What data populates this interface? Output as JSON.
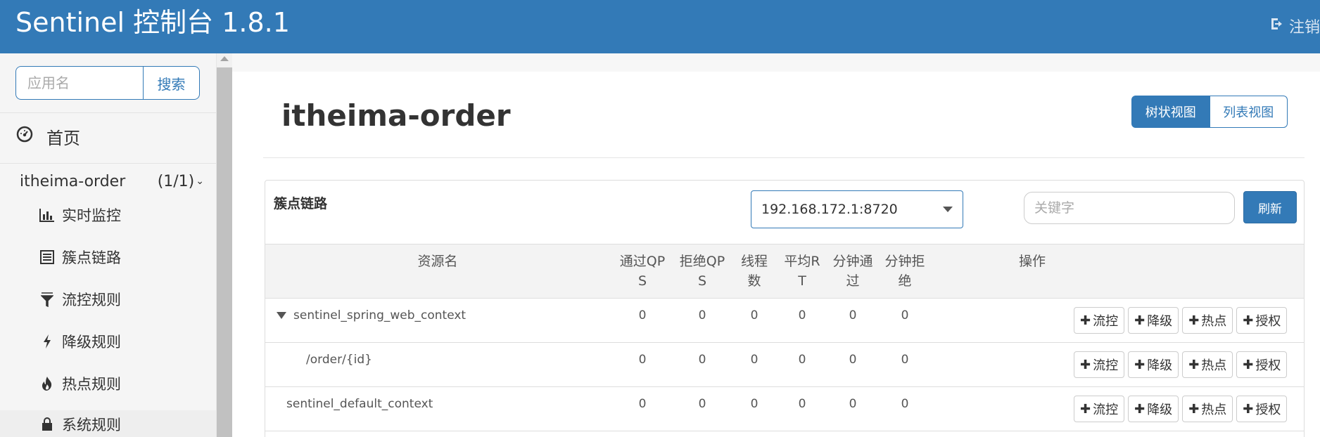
{
  "header": {
    "brand": "Sentinel 控制台 1.8.1",
    "logout_label": "注销",
    "logout_icon": "sign-out-icon"
  },
  "sidebar": {
    "search": {
      "placeholder": "应用名",
      "button_label": "搜索"
    },
    "home": {
      "label": "首页",
      "icon": "dashboard-icon"
    },
    "app": {
      "name": "itheima-order",
      "count": "(1/1)"
    },
    "items": [
      {
        "label": "实时监控",
        "icon": "bar-chart-icon"
      },
      {
        "label": "簇点链路",
        "icon": "list-icon"
      },
      {
        "label": "流控规则",
        "icon": "filter-icon"
      },
      {
        "label": "降级规则",
        "icon": "flash-icon"
      },
      {
        "label": "热点规则",
        "icon": "fire-icon"
      },
      {
        "label": "系统规则",
        "icon": "system-icon"
      }
    ]
  },
  "main": {
    "title": "itheima-order",
    "view_toggle": {
      "tree_label": "树状视图",
      "list_label": "列表视图",
      "active": "tree"
    },
    "panel": {
      "title": "簇点链路",
      "machine": "192.168.172.1:8720",
      "keyword_placeholder": "关键字",
      "refresh_label": "刷新"
    },
    "table": {
      "headers": {
        "resource": "资源名",
        "pass_qps_1": "通过QP",
        "pass_qps_2": "S",
        "block_qps_1": "拒绝QP",
        "block_qps_2": "S",
        "threads_1": "线程",
        "threads_2": "数",
        "avg_rt_1": "平均R",
        "avg_rt_2": "T",
        "minute_pass_1": "分钟通",
        "minute_pass_2": "过",
        "minute_block_1": "分钟拒",
        "minute_block_2": "绝",
        "ops": "操作"
      },
      "op_labels": {
        "flow": "流控",
        "degrade": "降级",
        "hotspot": "热点",
        "auth": "授权"
      },
      "rows": [
        {
          "name": "sentinel_spring_web_context",
          "expanded": true,
          "pass_qps": "0",
          "block_qps": "0",
          "threads": "0",
          "avg_rt": "0",
          "minute_pass": "0",
          "minute_block": "0"
        },
        {
          "name": "/order/{id}",
          "pass_qps": "0",
          "block_qps": "0",
          "threads": "0",
          "avg_rt": "0",
          "minute_pass": "0",
          "minute_block": "0"
        },
        {
          "name": "sentinel_default_context",
          "pass_qps": "0",
          "block_qps": "0",
          "threads": "0",
          "avg_rt": "0",
          "minute_pass": "0",
          "minute_block": "0"
        }
      ]
    }
  },
  "colors": {
    "primary": "#337ab7",
    "sidebar_bg": "#f5f5f5",
    "header_bg": "#337ab7"
  }
}
